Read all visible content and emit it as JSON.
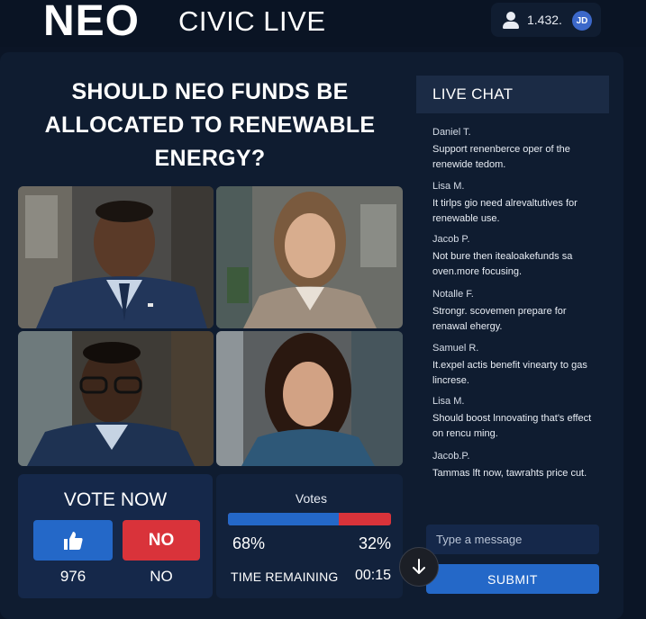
{
  "header": {
    "logo": "NEO",
    "brand": "CIVIC LIVE",
    "viewer_count": "1.432.",
    "avatar_initials": "JD"
  },
  "question": "SHOULD NEO FUNDS BE ALLOCATED TO RENEWABLE ENERGY?",
  "participants": [
    {
      "position": "top-left",
      "description": "man in navy suit"
    },
    {
      "position": "top-right",
      "description": "woman in grey blazer"
    },
    {
      "position": "bottom-left",
      "description": "man with glasses"
    },
    {
      "position": "bottom-right",
      "description": "woman with dark hair"
    }
  ],
  "vote": {
    "title": "VOTE NOW",
    "yes_icon": "thumbs-up-icon",
    "no_label": "NO",
    "yes_count": "976",
    "no_count": "NO"
  },
  "results": {
    "votes_label": " Votes",
    "yes_fraction": 0.68,
    "yes_pct": "68%",
    "no_pct": "32%",
    "time_label": "TIME REMAINING",
    "time_value": "00:15"
  },
  "chat": {
    "title": "LIVE CHAT",
    "messages": [
      {
        "author": "Daniel T.",
        "text": "Support renenberce oper of the renewide tedom."
      },
      {
        "author": "Lisa M.",
        "text": "It tirlps gio need alrevaltutives for renewable use."
      },
      {
        "author": "Jacob P.",
        "text": "Not bure then itealoakefunds sa oven.more focusing."
      },
      {
        "author": "Notalle F.",
        "text": "Strongr. scovemen prepare for renawal ehergy."
      },
      {
        "author": "Samuel R.",
        "text": "It.expel actis benefit vinearty to gas lincrese."
      },
      {
        "author": "Lisa M.",
        "text": "Should boost lnnovating that's effect on rencu ming."
      },
      {
        "author": "Jacob.P.",
        "text": "Tammas lft now, tawrahts price cut."
      }
    ],
    "input_placeholder": "Type a message",
    "submit_label": "SUBMIT"
  },
  "colors": {
    "background": "#0b1526",
    "accent_blue": "#2468c8",
    "accent_red": "#d9333a",
    "panel": "#0f1c30"
  }
}
